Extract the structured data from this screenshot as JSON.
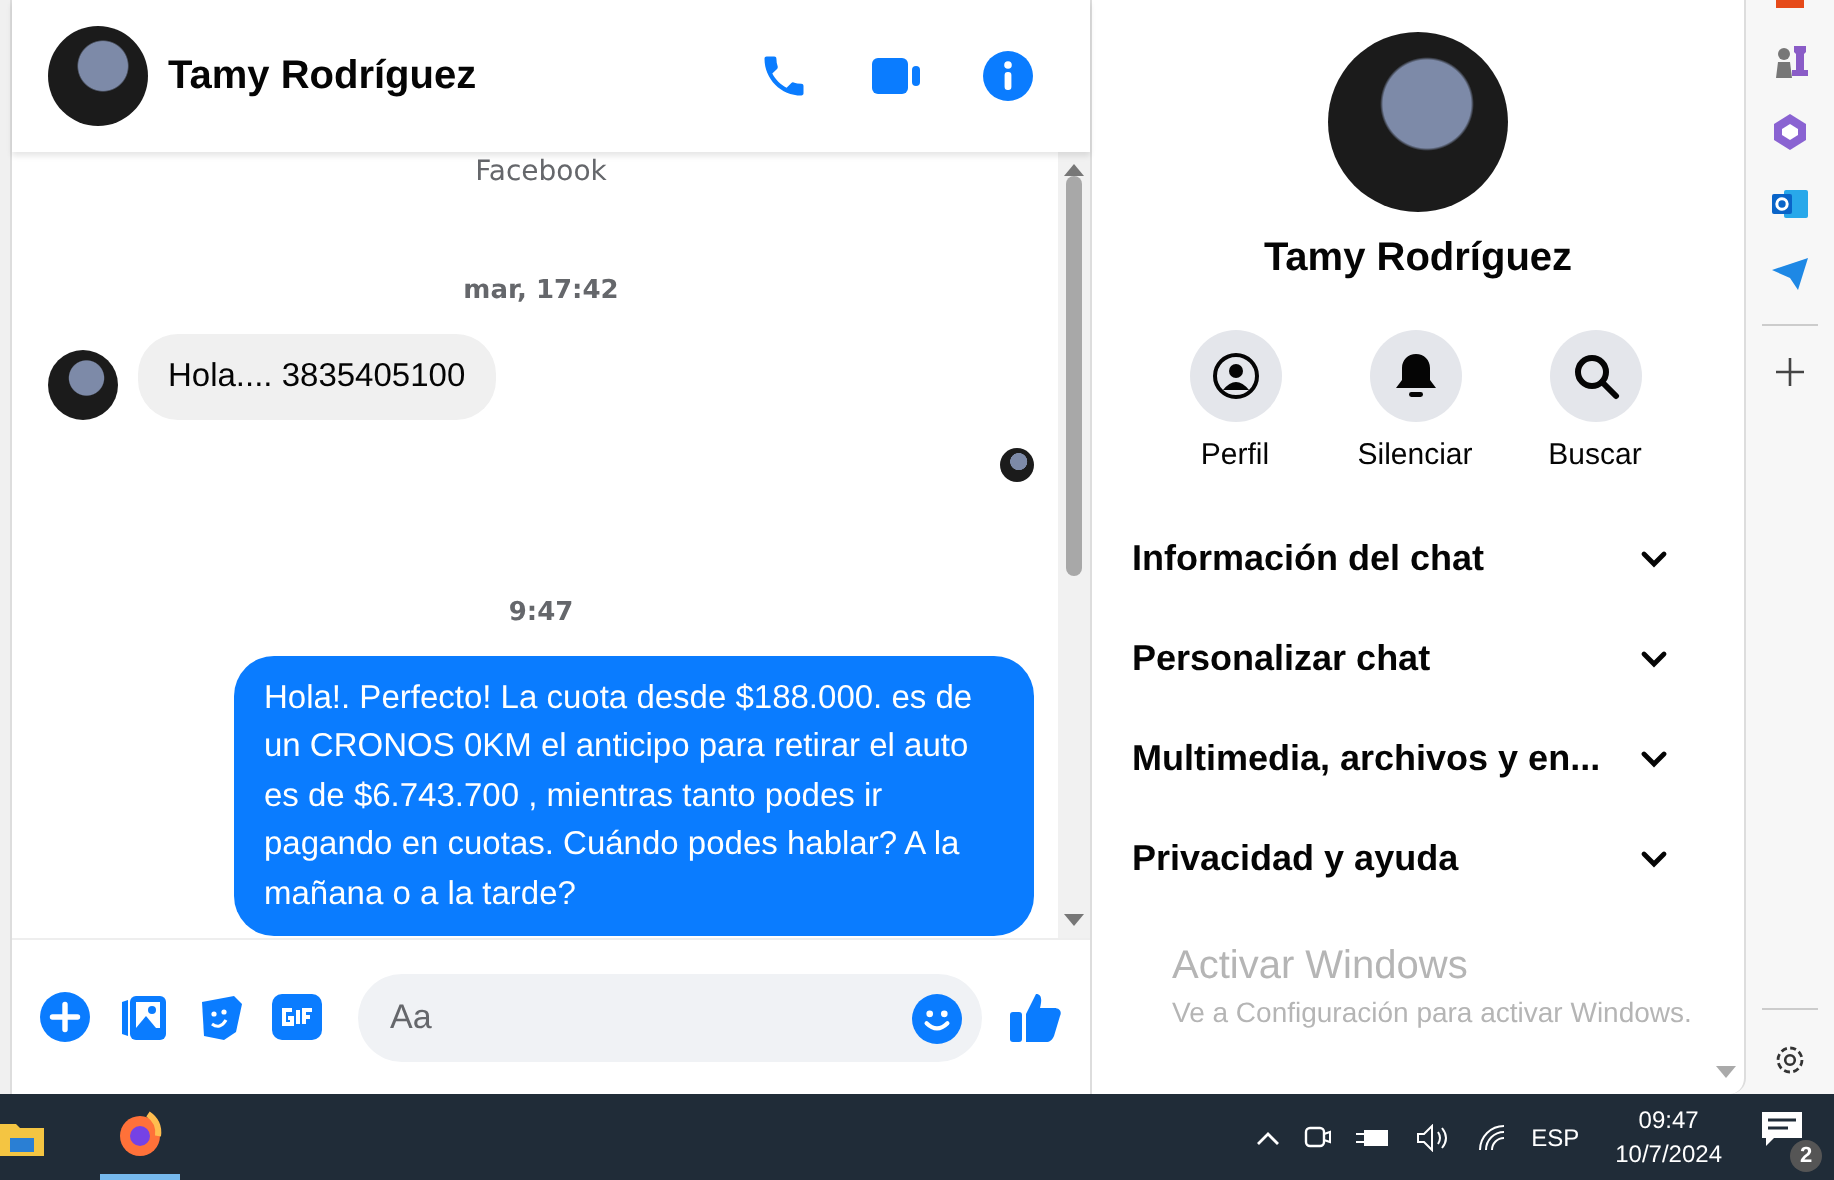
{
  "chat": {
    "contact_name": "Tamy Rodríguez",
    "messages": [
      {
        "kind": "system",
        "text": "Facebook"
      },
      {
        "kind": "timestamp",
        "text": "mar, 17:42"
      },
      {
        "kind": "incoming",
        "text": "Hola.... 3835405100"
      },
      {
        "kind": "seen"
      },
      {
        "kind": "timestamp",
        "text": "9:47"
      },
      {
        "kind": "outgoing",
        "text": "Hola!. Perfecto! La cuota desde $188.000. es de un CRONOS 0KM el anticipo para retirar el auto es de $6.743.700 , mientras tanto podes ir pagando en cuotas. Cuándo podes hablar? A la mañana o a la tarde?"
      }
    ],
    "composer": {
      "placeholder": "Aa"
    }
  },
  "info_panel": {
    "name": "Tamy Rodríguez",
    "actions": [
      {
        "kind": "profile",
        "label": "Perfil"
      },
      {
        "kind": "mute",
        "label": "Silenciar"
      },
      {
        "kind": "search",
        "label": "Buscar"
      }
    ],
    "sections": [
      {
        "label": "Información del chat",
        "expanded": false
      },
      {
        "label": "Personalizar chat",
        "expanded": false
      },
      {
        "label": "Multimedia, archivos y en...",
        "expanded": false
      },
      {
        "label": "Privacidad y ayuda",
        "expanded": false
      }
    ]
  },
  "activation_notice": {
    "title": "Activar Windows",
    "text": "Ve a Configuración para activar Windows."
  },
  "taskbar": {
    "language": "ESP",
    "time": "09:47",
    "date": "10/7/2024",
    "notification_count": "2"
  }
}
